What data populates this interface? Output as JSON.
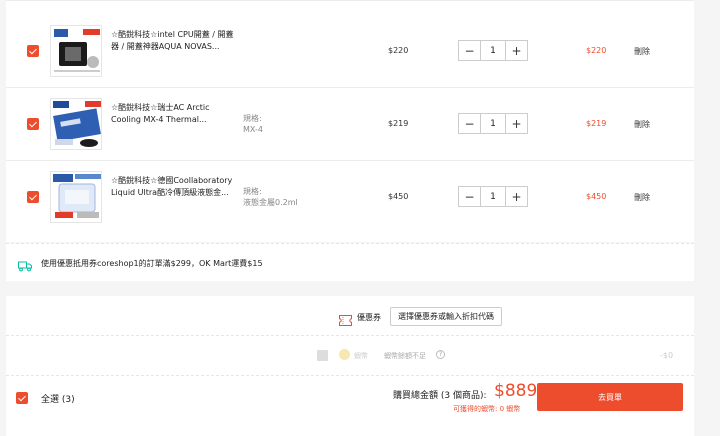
{
  "cart": {
    "items": [
      {
        "name": "☆酷銳科技☆intel CPU開蓋 / 開蓋器 / 開蓋神器AQUA NOVAS...",
        "variant_label": "",
        "variant_value": "",
        "price": "$220",
        "quantity": "1",
        "total": "$220",
        "delete_label": "刪除"
      },
      {
        "name": "☆酷銳科技☆瑞士AC Arctic Cooling MX-4 Thermal...",
        "variant_label": "規格:",
        "variant_value": "MX-4",
        "price": "$219",
        "quantity": "1",
        "total": "$219",
        "delete_label": "刪除"
      },
      {
        "name": "☆酷銳科技☆德國Coollaboratory Liquid Ultra酷冷傳頂級液態金...",
        "variant_label": "規格:",
        "variant_value": "液態金屬0.2ml",
        "price": "$450",
        "quantity": "1",
        "total": "$450",
        "delete_label": "刪除"
      }
    ],
    "minus_symbol": "−",
    "plus_symbol": "+"
  },
  "shipping": {
    "text": "使用優惠抵用券coreshop1的訂單滿$299，OK Mart運費$15"
  },
  "voucher": {
    "label": "優惠券",
    "button_label": "選擇優惠券或輸入折扣代碼"
  },
  "coins": {
    "name": "蝦幣",
    "message": "蝦幣餘額不足",
    "help_symbol": "?",
    "amount": "-$0"
  },
  "footer": {
    "select_all_label": "全選 (3)",
    "total_label": "購買總金額 (3 個商品):",
    "total_amount": "$889",
    "coins_earned": "可獲得的蝦幣: 0 蝦幣",
    "checkout_label": "去買單"
  },
  "colors": {
    "accent": "#ee4d2d"
  },
  "icons": {
    "shipping": "truck-icon",
    "voucher": "ticket-icon",
    "coin": "coin-icon",
    "help": "help-icon"
  }
}
